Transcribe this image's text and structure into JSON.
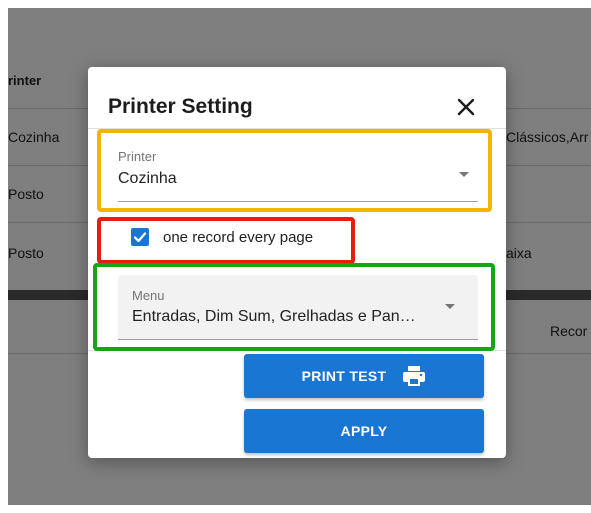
{
  "background": {
    "column_header": "rinter",
    "rows": [
      {
        "printer": "Cozinha",
        "menus": "Clássicos,Arr"
      },
      {
        "printer": "Posto",
        "menus": ""
      },
      {
        "printer": "Posto",
        "menus": "aixa"
      }
    ],
    "footer_text": "Recor"
  },
  "dialog": {
    "title": "Printer Setting",
    "printer_field": {
      "label": "Printer",
      "value": "Cozinha"
    },
    "checkbox": {
      "label": "one record every page",
      "checked": true
    },
    "menu_field": {
      "label": "Menu",
      "value": "Entradas, Dim Sum, Grelhadas e Pan…"
    },
    "print_test_label": "PRINT TEST",
    "apply_label": "APPLY"
  },
  "colors": {
    "primary": "#1976d2",
    "highlight_yellow": "#f4b400",
    "highlight_red": "#ea1c0d",
    "highlight_green": "#1aa31a"
  },
  "icons": [
    "close-icon",
    "dropdown-arrow-icon",
    "check-icon",
    "printer-icon"
  ]
}
